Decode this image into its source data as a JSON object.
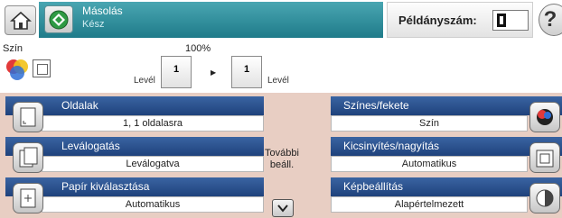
{
  "header": {
    "status_title": "Másolás",
    "status_subtitle": "Kész",
    "copies_label": "Példányszám:",
    "copies_value": "1",
    "help_glyph": "?",
    "accent_color": "#2b8b99",
    "icons": [
      "home-icon",
      "start-copy-icon",
      "help-icon"
    ]
  },
  "preview": {
    "color_label": "Szín",
    "zoom_label": "100%",
    "original_sheet": "1",
    "output_sheet": "1",
    "original_label": "Levél",
    "output_label": "Levél",
    "icons": [
      "color-mode-icon",
      "duplex-icon",
      "arrow-right-icon"
    ]
  },
  "settings": {
    "more_label_line1": "További",
    "more_label_line2": "beáll.",
    "left": [
      {
        "title": "Oldalak",
        "value": "1, 1 oldalasra",
        "icon": "sides-icon"
      },
      {
        "title": "Leválogatás",
        "value": "Leválogatva",
        "icon": "collate-icon"
      },
      {
        "title": "Papír kiválasztása",
        "value": "Automatikus",
        "icon": "paper-select-icon"
      }
    ],
    "right": [
      {
        "title": "Színes/fekete",
        "value": "Szín",
        "icon": "color-black-icon"
      },
      {
        "title": "Kicsinyítés/nagyítás",
        "value": "Automatikus",
        "icon": "reduce-enlarge-icon"
      },
      {
        "title": "Képbeállítás",
        "value": "Alapértelmezett",
        "icon": "image-adjust-icon"
      }
    ],
    "colors": {
      "header_blue": "#2b4f8c",
      "background": "#e8cec3"
    }
  }
}
